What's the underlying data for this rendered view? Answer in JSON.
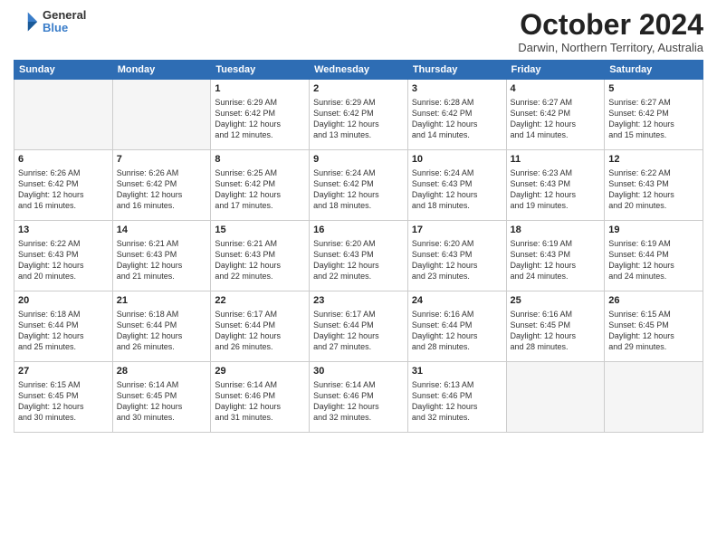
{
  "header": {
    "logo_line1": "General",
    "logo_line2": "Blue",
    "month_title": "October 2024",
    "subtitle": "Darwin, Northern Territory, Australia"
  },
  "weekdays": [
    "Sunday",
    "Monday",
    "Tuesday",
    "Wednesday",
    "Thursday",
    "Friday",
    "Saturday"
  ],
  "weeks": [
    [
      {
        "day": "",
        "info": ""
      },
      {
        "day": "",
        "info": ""
      },
      {
        "day": "1",
        "info": "Sunrise: 6:29 AM\nSunset: 6:42 PM\nDaylight: 12 hours\nand 12 minutes."
      },
      {
        "day": "2",
        "info": "Sunrise: 6:29 AM\nSunset: 6:42 PM\nDaylight: 12 hours\nand 13 minutes."
      },
      {
        "day": "3",
        "info": "Sunrise: 6:28 AM\nSunset: 6:42 PM\nDaylight: 12 hours\nand 14 minutes."
      },
      {
        "day": "4",
        "info": "Sunrise: 6:27 AM\nSunset: 6:42 PM\nDaylight: 12 hours\nand 14 minutes."
      },
      {
        "day": "5",
        "info": "Sunrise: 6:27 AM\nSunset: 6:42 PM\nDaylight: 12 hours\nand 15 minutes."
      }
    ],
    [
      {
        "day": "6",
        "info": "Sunrise: 6:26 AM\nSunset: 6:42 PM\nDaylight: 12 hours\nand 16 minutes."
      },
      {
        "day": "7",
        "info": "Sunrise: 6:26 AM\nSunset: 6:42 PM\nDaylight: 12 hours\nand 16 minutes."
      },
      {
        "day": "8",
        "info": "Sunrise: 6:25 AM\nSunset: 6:42 PM\nDaylight: 12 hours\nand 17 minutes."
      },
      {
        "day": "9",
        "info": "Sunrise: 6:24 AM\nSunset: 6:42 PM\nDaylight: 12 hours\nand 18 minutes."
      },
      {
        "day": "10",
        "info": "Sunrise: 6:24 AM\nSunset: 6:43 PM\nDaylight: 12 hours\nand 18 minutes."
      },
      {
        "day": "11",
        "info": "Sunrise: 6:23 AM\nSunset: 6:43 PM\nDaylight: 12 hours\nand 19 minutes."
      },
      {
        "day": "12",
        "info": "Sunrise: 6:22 AM\nSunset: 6:43 PM\nDaylight: 12 hours\nand 20 minutes."
      }
    ],
    [
      {
        "day": "13",
        "info": "Sunrise: 6:22 AM\nSunset: 6:43 PM\nDaylight: 12 hours\nand 20 minutes."
      },
      {
        "day": "14",
        "info": "Sunrise: 6:21 AM\nSunset: 6:43 PM\nDaylight: 12 hours\nand 21 minutes."
      },
      {
        "day": "15",
        "info": "Sunrise: 6:21 AM\nSunset: 6:43 PM\nDaylight: 12 hours\nand 22 minutes."
      },
      {
        "day": "16",
        "info": "Sunrise: 6:20 AM\nSunset: 6:43 PM\nDaylight: 12 hours\nand 22 minutes."
      },
      {
        "day": "17",
        "info": "Sunrise: 6:20 AM\nSunset: 6:43 PM\nDaylight: 12 hours\nand 23 minutes."
      },
      {
        "day": "18",
        "info": "Sunrise: 6:19 AM\nSunset: 6:43 PM\nDaylight: 12 hours\nand 24 minutes."
      },
      {
        "day": "19",
        "info": "Sunrise: 6:19 AM\nSunset: 6:44 PM\nDaylight: 12 hours\nand 24 minutes."
      }
    ],
    [
      {
        "day": "20",
        "info": "Sunrise: 6:18 AM\nSunset: 6:44 PM\nDaylight: 12 hours\nand 25 minutes."
      },
      {
        "day": "21",
        "info": "Sunrise: 6:18 AM\nSunset: 6:44 PM\nDaylight: 12 hours\nand 26 minutes."
      },
      {
        "day": "22",
        "info": "Sunrise: 6:17 AM\nSunset: 6:44 PM\nDaylight: 12 hours\nand 26 minutes."
      },
      {
        "day": "23",
        "info": "Sunrise: 6:17 AM\nSunset: 6:44 PM\nDaylight: 12 hours\nand 27 minutes."
      },
      {
        "day": "24",
        "info": "Sunrise: 6:16 AM\nSunset: 6:44 PM\nDaylight: 12 hours\nand 28 minutes."
      },
      {
        "day": "25",
        "info": "Sunrise: 6:16 AM\nSunset: 6:45 PM\nDaylight: 12 hours\nand 28 minutes."
      },
      {
        "day": "26",
        "info": "Sunrise: 6:15 AM\nSunset: 6:45 PM\nDaylight: 12 hours\nand 29 minutes."
      }
    ],
    [
      {
        "day": "27",
        "info": "Sunrise: 6:15 AM\nSunset: 6:45 PM\nDaylight: 12 hours\nand 30 minutes."
      },
      {
        "day": "28",
        "info": "Sunrise: 6:14 AM\nSunset: 6:45 PM\nDaylight: 12 hours\nand 30 minutes."
      },
      {
        "day": "29",
        "info": "Sunrise: 6:14 AM\nSunset: 6:46 PM\nDaylight: 12 hours\nand 31 minutes."
      },
      {
        "day": "30",
        "info": "Sunrise: 6:14 AM\nSunset: 6:46 PM\nDaylight: 12 hours\nand 32 minutes."
      },
      {
        "day": "31",
        "info": "Sunrise: 6:13 AM\nSunset: 6:46 PM\nDaylight: 12 hours\nand 32 minutes."
      },
      {
        "day": "",
        "info": ""
      },
      {
        "day": "",
        "info": ""
      }
    ]
  ]
}
